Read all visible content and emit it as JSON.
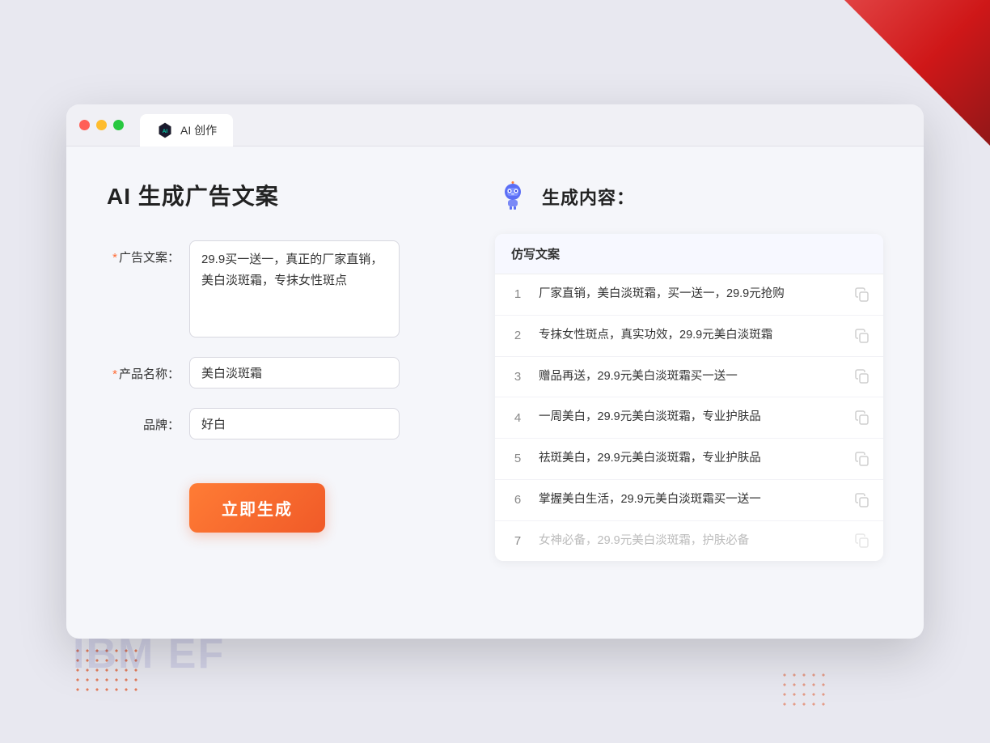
{
  "window": {
    "tab_label": "AI 创作"
  },
  "left_panel": {
    "page_title": "AI 生成广告文案",
    "form": {
      "ad_copy_label": "广告文案：",
      "ad_copy_required": "*",
      "ad_copy_value": "29.9买一送一，真正的厂家直销，美白淡斑霜，专抹女性斑点",
      "product_name_label": "产品名称：",
      "product_name_required": "*",
      "product_name_value": "美白淡斑霜",
      "brand_label": "品牌：",
      "brand_value": "好白",
      "submit_label": "立即生成"
    }
  },
  "right_panel": {
    "result_title": "生成内容：",
    "table_header": "仿写文案",
    "rows": [
      {
        "num": "1",
        "text": "厂家直销，美白淡斑霜，买一送一，29.9元抢购",
        "faded": false
      },
      {
        "num": "2",
        "text": "专抹女性斑点，真实功效，29.9元美白淡斑霜",
        "faded": false
      },
      {
        "num": "3",
        "text": "赠品再送，29.9元美白淡斑霜买一送一",
        "faded": false
      },
      {
        "num": "4",
        "text": "一周美白，29.9元美白淡斑霜，专业护肤品",
        "faded": false
      },
      {
        "num": "5",
        "text": "祛斑美白，29.9元美白淡斑霜，专业护肤品",
        "faded": false
      },
      {
        "num": "6",
        "text": "掌握美白生活，29.9元美白淡斑霜买一送一",
        "faded": false
      },
      {
        "num": "7",
        "text": "女神必备，29.9元美白淡斑霜，护肤必备",
        "faded": true
      }
    ]
  },
  "decorative": {
    "ibmef_text": "IBM EF"
  }
}
